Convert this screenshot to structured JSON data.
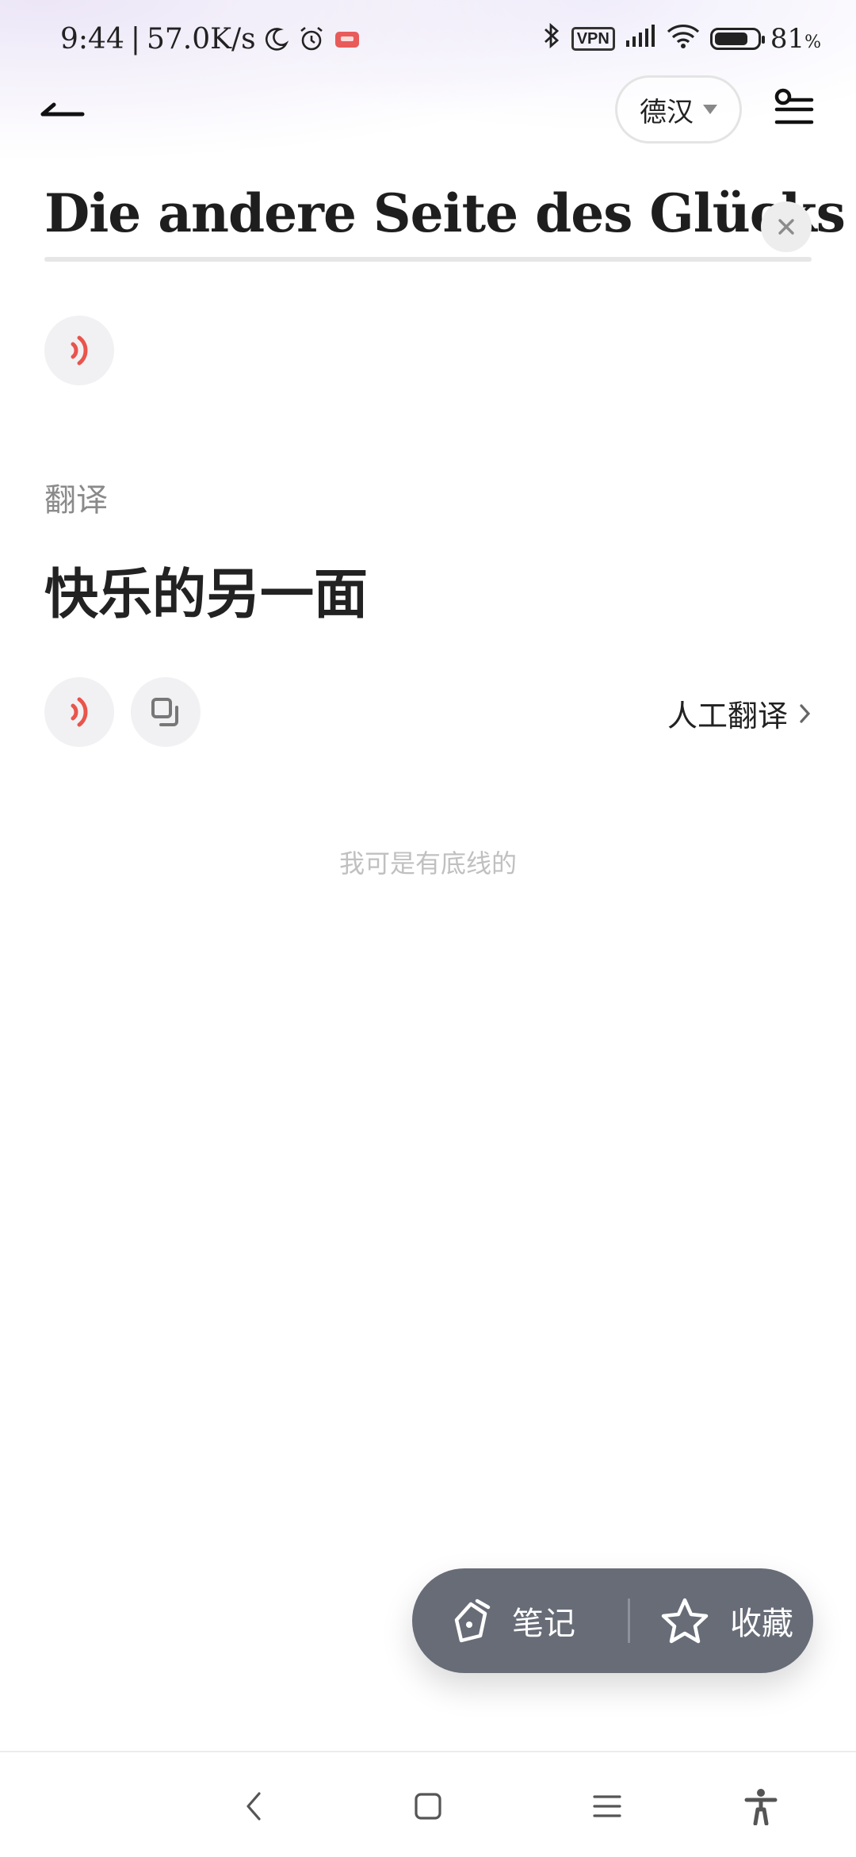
{
  "status_bar": {
    "time": "9:44",
    "separator": "|",
    "speed": "57.0K/s",
    "vpn_label": "VPN",
    "battery_percent": "81",
    "battery_unit": "%",
    "battery_level": 0.81
  },
  "header": {
    "language_pair": "德汉",
    "icons": {
      "back": "back-arrow-icon",
      "settings": "settings-sliders-icon",
      "dropdown": "caret-down-icon"
    }
  },
  "source": {
    "text": "Die andere Seite des Glücks",
    "clear_icon": "close-icon"
  },
  "translation_section": {
    "label": "翻译",
    "text": "快乐的另一面",
    "human_translation_link": "人工翻译"
  },
  "footer_note": "我可是有底线的",
  "floating_actions": {
    "note_label": "笔记",
    "favorite_label": "收藏"
  },
  "colors": {
    "speaker_red": "#e9544c",
    "pill_bg": "#676c77",
    "icon_bg": "#f1f1f3"
  }
}
